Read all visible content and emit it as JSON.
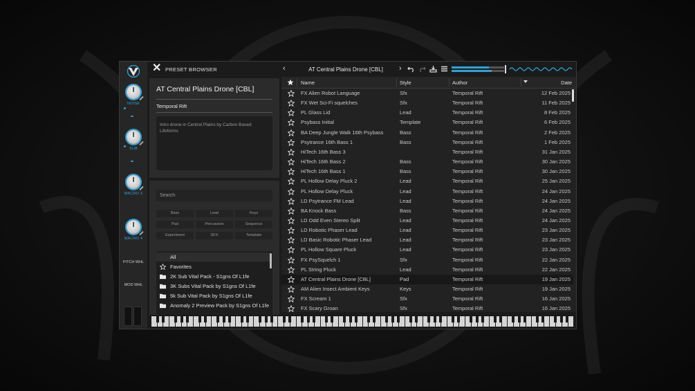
{
  "app": {
    "browser_title": "PRESET BROWSER",
    "current_preset": "AT Central Plains Drone [CBL]"
  },
  "macros": [
    {
      "label": "NOISE"
    },
    {
      "label": "SUB"
    },
    {
      "label": "MACRO 3"
    },
    {
      "label": "MACRO 4"
    }
  ],
  "wheels": {
    "pitch": "PITCH WHL",
    "mod": "MOD WHL"
  },
  "preset_info": {
    "name": "AT Central Plains Drone [CBL]",
    "author": "Temporal Rift",
    "description": "Intro drone in Central Plains by Carbon Based Lifeforms"
  },
  "search": {
    "placeholder": "Search"
  },
  "tags": [
    "Bass",
    "Lead",
    "Keys",
    "Pad",
    "Percussion",
    "Sequence",
    "Experiment",
    "SFX",
    "Template"
  ],
  "folders": [
    {
      "label": "All",
      "icon": "none"
    },
    {
      "label": "Favorites",
      "icon": "star-icon"
    },
    {
      "label": "2K Sub Vital Pack - S1gns Of L1fe",
      "icon": "folder-icon"
    },
    {
      "label": "3K Subs Vital Pack by S1gns Of L1fe",
      "icon": "folder-icon"
    },
    {
      "label": "5k Sub Vital Pack by S1gns Of L1fe",
      "icon": "folder-icon"
    },
    {
      "label": "Anomaly 2 Preview Pack by S1gns Of L1fe",
      "icon": "folder-icon"
    }
  ],
  "table": {
    "headers": {
      "name": "Name",
      "style": "Style",
      "author": "Author",
      "date": "Date"
    },
    "rows": [
      {
        "name": "FX Alien Robot Language",
        "style": "Sfx",
        "author": "Temporal Rift",
        "date": "12 Feb 2025"
      },
      {
        "name": "FX Wet Sci-Fi squelches",
        "style": "Sfx",
        "author": "Temporal Rift",
        "date": "11 Feb 2025"
      },
      {
        "name": "PL Glass Lid",
        "style": "Lead",
        "author": "Temporal Rift",
        "date": "8 Feb 2025"
      },
      {
        "name": "Psybass Initial",
        "style": "Template",
        "author": "Temporal Rift",
        "date": "6 Feb 2025"
      },
      {
        "name": "BA Deep Jungle Walk 16th Psybass",
        "style": "Bass",
        "author": "Temporal Rift",
        "date": "2 Feb 2025"
      },
      {
        "name": "Psytrance 16th Bass 1",
        "style": "Bass",
        "author": "Temporal Rift",
        "date": "1 Feb 2025"
      },
      {
        "name": "HiTech 16th Bass 3",
        "style": "",
        "author": "Temporal Rift",
        "date": "31 Jan 2025"
      },
      {
        "name": "HiTech 16th Bass 2",
        "style": "Bass",
        "author": "Temporal Rift",
        "date": "30 Jan 2025"
      },
      {
        "name": "HiTech 16th Bass 1",
        "style": "Bass",
        "author": "Temporal Rift",
        "date": "30 Jan 2025"
      },
      {
        "name": "PL Hollow Delay Pluck 2",
        "style": "Lead",
        "author": "Temporal Rift",
        "date": "25 Jan 2025"
      },
      {
        "name": "PL Hollow Delay Pluck",
        "style": "Lead",
        "author": "Temporal Rift",
        "date": "24 Jan 2025"
      },
      {
        "name": "LD Psytrance FM Lead",
        "style": "Lead",
        "author": "Temporal Rift",
        "date": "24 Jan 2025"
      },
      {
        "name": "BA Knock Bass",
        "style": "Bass",
        "author": "Temporal Rift",
        "date": "24 Jan 2025"
      },
      {
        "name": "LD Odd Even Stereo Split",
        "style": "Lead",
        "author": "Temporal Rift",
        "date": "24 Jan 2025"
      },
      {
        "name": "LD Robotic Phaser Lead",
        "style": "Lead",
        "author": "Temporal Rift",
        "date": "23 Jan 2025"
      },
      {
        "name": "LD Basic Robotic Phaser Lead",
        "style": "Lead",
        "author": "Temporal Rift",
        "date": "23 Jan 2025"
      },
      {
        "name": "PL Hollow Square Pluck",
        "style": "Lead",
        "author": "Temporal Rift",
        "date": "23 Jan 2025"
      },
      {
        "name": "FX PsySquelch 1",
        "style": "Sfx",
        "author": "Temporal Rift",
        "date": "22 Jan 2025"
      },
      {
        "name": "PL String Pluck",
        "style": "Lead",
        "author": "Temporal Rift",
        "date": "22 Jan 2025"
      },
      {
        "name": "AT Central Plains Drone [CBL]",
        "style": "Pad",
        "author": "Temporal Rift",
        "date": "19 Jan 2025",
        "selected": true
      },
      {
        "name": "AM Alien Insect Ambient Keys",
        "style": "Keys",
        "author": "Temporal Rift",
        "date": "19 Jan 2025"
      },
      {
        "name": "FX Scream 1",
        "style": "Sfx",
        "author": "Temporal Rift",
        "date": "16 Jan 2025"
      },
      {
        "name": "FX Scary Groan",
        "style": "Sfx",
        "author": "Temporal Rift",
        "date": "16 Jan 2025"
      }
    ]
  },
  "colors": {
    "accent": "#2fa3d6",
    "panel": "#2b2b2b",
    "background": "#1b1b1b"
  }
}
